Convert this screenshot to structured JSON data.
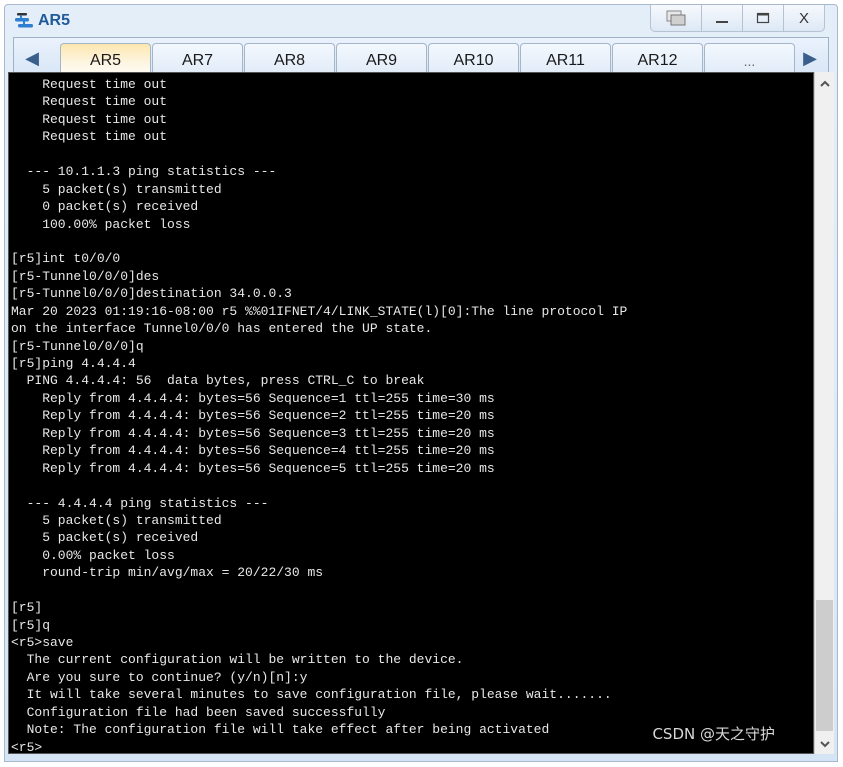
{
  "window": {
    "title": "AR5",
    "icon": "router-topology-icon",
    "controls": [
      {
        "name": "restore-window-button",
        "icon": "restore-icon",
        "label": "❐"
      },
      {
        "name": "minimize-button",
        "icon": "minimize-icon",
        "label": "_"
      },
      {
        "name": "maximize-button",
        "icon": "maximize-icon",
        "label": "▭"
      },
      {
        "name": "close-button",
        "icon": "close-icon",
        "label": "X"
      }
    ]
  },
  "tabbar": {
    "prev_label": "◀",
    "next_label": "▶",
    "tabs": [
      {
        "label": "AR5",
        "active": true
      },
      {
        "label": "AR7",
        "active": false
      },
      {
        "label": "AR8",
        "active": false
      },
      {
        "label": "AR9",
        "active": false
      },
      {
        "label": "AR10",
        "active": false
      },
      {
        "label": "AR11",
        "active": false
      },
      {
        "label": "AR12",
        "active": false
      },
      {
        "label": "...",
        "active": false
      }
    ]
  },
  "terminal": {
    "lines": [
      "    Request time out",
      "    Request time out",
      "    Request time out",
      "    Request time out",
      "",
      "  --- 10.1.1.3 ping statistics ---",
      "    5 packet(s) transmitted",
      "    0 packet(s) received",
      "    100.00% packet loss",
      "",
      "[r5]int t0/0/0",
      "[r5-Tunnel0/0/0]des",
      "[r5-Tunnel0/0/0]destination 34.0.0.3",
      "Mar 20 2023 01:19:16-08:00 r5 %%01IFNET/4/LINK_STATE(l)[0]:The line protocol IP",
      "on the interface Tunnel0/0/0 has entered the UP state.",
      "[r5-Tunnel0/0/0]q",
      "[r5]ping 4.4.4.4",
      "  PING 4.4.4.4: 56  data bytes, press CTRL_C to break",
      "    Reply from 4.4.4.4: bytes=56 Sequence=1 ttl=255 time=30 ms",
      "    Reply from 4.4.4.4: bytes=56 Sequence=2 ttl=255 time=20 ms",
      "    Reply from 4.4.4.4: bytes=56 Sequence=3 ttl=255 time=20 ms",
      "    Reply from 4.4.4.4: bytes=56 Sequence=4 ttl=255 time=20 ms",
      "    Reply from 4.4.4.4: bytes=56 Sequence=5 ttl=255 time=20 ms",
      "",
      "  --- 4.4.4.4 ping statistics ---",
      "    5 packet(s) transmitted",
      "    5 packet(s) received",
      "    0.00% packet loss",
      "    round-trip min/avg/max = 20/22/30 ms",
      "",
      "[r5]",
      "[r5]q",
      "<r5>save",
      "  The current configuration will be written to the device.",
      "  Are you sure to continue? (y/n)[n]:y",
      "  It will take several minutes to save configuration file, please wait.......",
      "  Configuration file had been saved successfully",
      "  Note: The configuration file will take effect after being activated",
      "<r5>"
    ]
  },
  "scrollbar": {
    "up_label": "^",
    "down_label": "v",
    "position_fraction": 1.0
  },
  "watermark": "CSDN @天之守护"
}
